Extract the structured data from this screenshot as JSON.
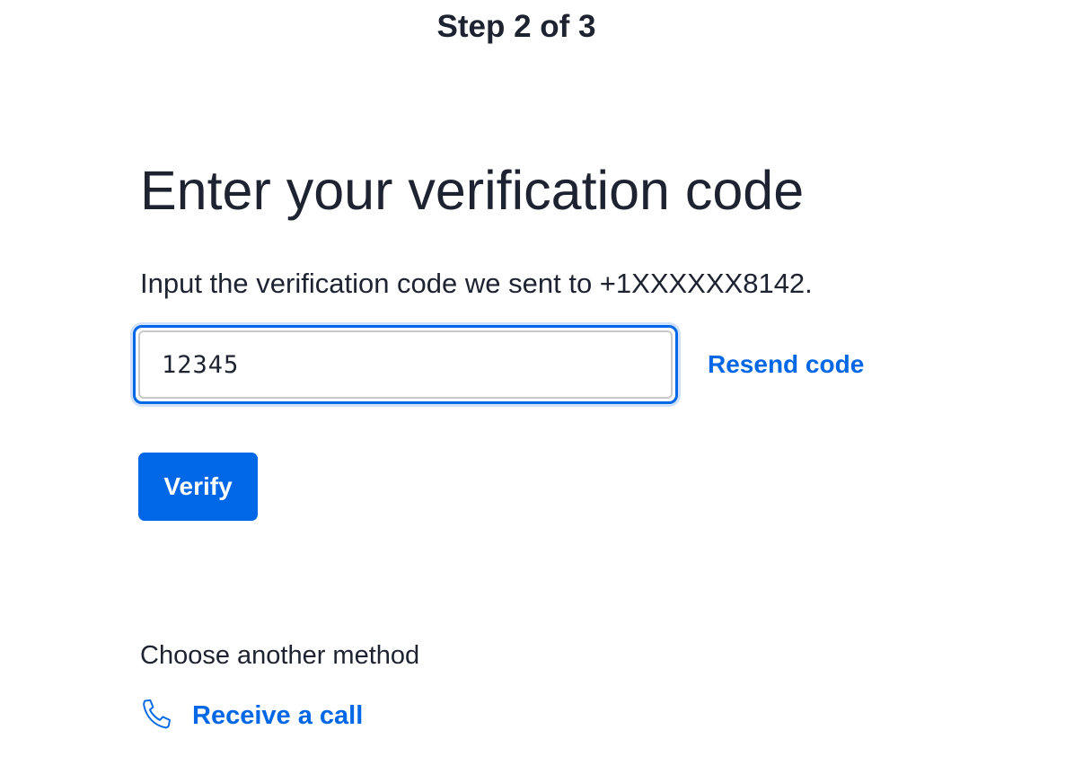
{
  "header": {
    "step_text": "Step 2 of 3"
  },
  "main": {
    "title": "Enter your verification code",
    "instructions": "Input the verification code we sent to +1XXXXXX8142.",
    "code_input": {
      "value": "12345",
      "placeholder": ""
    },
    "resend_label": "Resend code",
    "verify_label": "Verify"
  },
  "alternatives": {
    "heading": "Choose another method",
    "options": [
      {
        "label": "Receive a call",
        "icon": "phone-icon"
      }
    ]
  },
  "colors": {
    "accent": "#0067e6",
    "text": "#1d2330",
    "focus_ring": "#cfe1fb"
  }
}
